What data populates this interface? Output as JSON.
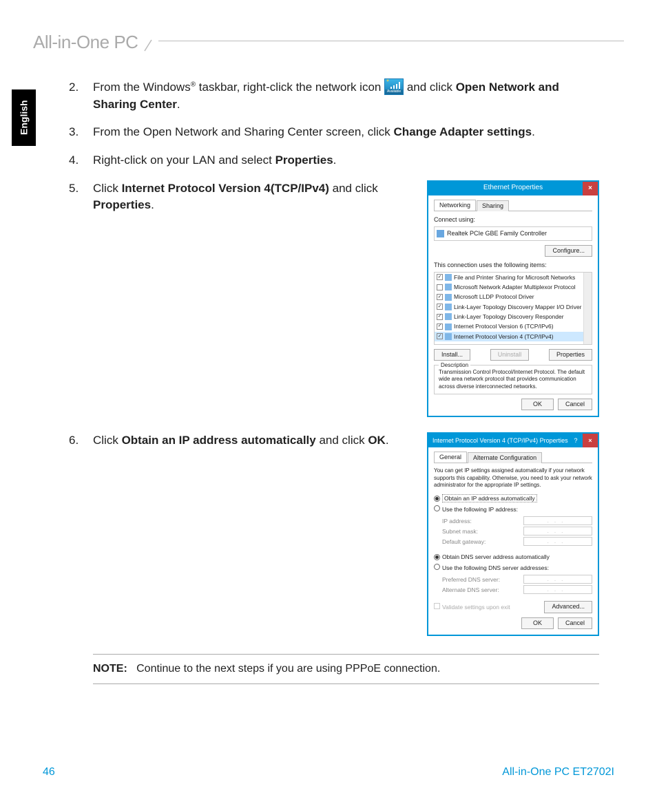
{
  "header": {
    "title": "All-in-One PC"
  },
  "lang": "English",
  "steps": {
    "s2num": "2.",
    "s2a": "From the Windows",
    "s2reg": "®",
    "s2b": " taskbar, right-click the network icon ",
    "s2c": " and click ",
    "s2bold": "Open Network and Sharing Center",
    "s2d": ".",
    "netAvail": "Available",
    "s3num": "3.",
    "s3a": "From the Open Network and Sharing Center screen, click ",
    "s3bold": "Change Adapter settings",
    "s3b": ".",
    "s4num": "4.",
    "s4a": "Right-click on your LAN and select ",
    "s4bold": "Properties",
    "s4b": ".",
    "s5num": "5.",
    "s5a": "Click ",
    "s5bold1": "Internet Protocol Version 4(TCP/IPv4)",
    "s5b": " and click ",
    "s5bold2": "Properties",
    "s5c": ".",
    "s6num": "6.",
    "s6a": "Click ",
    "s6bold1": "Obtain an IP address automatically",
    "s6b": " and click ",
    "s6bold2": "OK",
    "s6c": "."
  },
  "dlg1": {
    "title": "Ethernet Properties",
    "tabNetworking": "Networking",
    "tabSharing": "Sharing",
    "connectUsing": "Connect using:",
    "adapter": "Realtek PCIe GBE Family Controller",
    "configure": "Configure...",
    "usesItems": "This connection uses the following items:",
    "items": [
      "File and Printer Sharing for Microsoft Networks",
      "Microsoft Network Adapter Multiplexor Protocol",
      "Microsoft LLDP Protocol Driver",
      "Link-Layer Topology Discovery Mapper I/O Driver",
      "Link-Layer Topology Discovery Responder",
      "Internet Protocol Version 6 (TCP/IPv6)",
      "Internet Protocol Version 4 (TCP/IPv4)"
    ],
    "install": "Install...",
    "uninstall": "Uninstall",
    "properties": "Properties",
    "descLabel": "Description",
    "desc": "Transmission Control Protocol/Internet Protocol. The default wide area network protocol that provides communication across diverse interconnected networks.",
    "ok": "OK",
    "cancel": "Cancel"
  },
  "dlg2": {
    "title": "Internet Protocol Version 4 (TCP/IPv4) Properties",
    "tabGeneral": "General",
    "tabAlt": "Alternate Configuration",
    "blurb": "You can get IP settings assigned automatically if your network supports this capability. Otherwise, you need to ask your network administrator for the appropriate IP settings.",
    "optAuto": "Obtain an IP address automatically",
    "optManual": "Use the following IP address:",
    "ip": "IP address:",
    "subnet": "Subnet mask:",
    "gateway": "Default gateway:",
    "dnsAuto": "Obtain DNS server address automatically",
    "dnsManual": "Use the following DNS server addresses:",
    "prefDns": "Preferred DNS server:",
    "altDns": "Alternate DNS server:",
    "validate": "Validate settings upon exit",
    "advanced": "Advanced...",
    "ok": "OK",
    "cancel": "Cancel"
  },
  "note": {
    "label": "NOTE:",
    "text": "Continue to the next steps if you are using PPPoE connection."
  },
  "footer": {
    "page": "46",
    "product": "All-in-One PC ET2702I"
  }
}
